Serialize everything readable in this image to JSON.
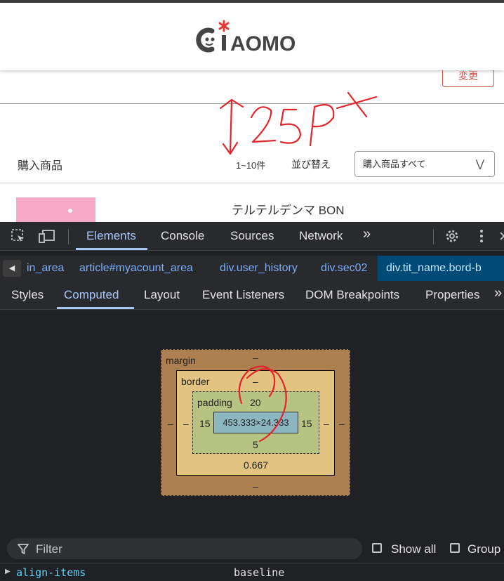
{
  "webpage": {
    "logo_text": "CiAOMO",
    "edit_button": "変更",
    "section_title": "購入商品",
    "item_count": "1~10件",
    "sort_label": "並び替え",
    "filter_select": {
      "value": "購入商品すべて"
    },
    "product_name": "テルテルデンマ BON",
    "annotation_text": "25px"
  },
  "devtools": {
    "main_tabs": [
      {
        "label": "Elements",
        "active": true
      },
      {
        "label": "Console"
      },
      {
        "label": "Sources"
      },
      {
        "label": "Network"
      }
    ],
    "more_tabs": "»",
    "breadcrumbs": [
      "in_area",
      "article#myacount_area",
      "div.user_history",
      "div.sec02",
      "div.tit_name.bord-b"
    ],
    "sub_tabs": [
      {
        "label": "Styles"
      },
      {
        "label": "Computed",
        "active": true
      },
      {
        "label": "Layout"
      },
      {
        "label": "Event Listeners"
      },
      {
        "label": "DOM Breakpoints"
      },
      {
        "label": "Properties"
      }
    ],
    "box_model": {
      "margin_label": "margin",
      "margin": {
        "top": "–",
        "right": "–",
        "bottom": "–",
        "left": "–"
      },
      "border_label": "border",
      "border": {
        "top": "–",
        "right": "–",
        "bottom": "0.667",
        "left": "–"
      },
      "padding_label": "padding",
      "padding": {
        "top": "20",
        "right": "15",
        "bottom": "5",
        "left": "15"
      },
      "content": "453.333×24.333"
    },
    "filter": {
      "placeholder": "Filter"
    },
    "show_all_label": "Show all",
    "group_label": "Group",
    "property": {
      "name": "align-items",
      "value": "baseline"
    },
    "colors": {
      "accent": "#a8c7fa",
      "margin": "#ad8052",
      "border": "#e3c381",
      "padding": "#b7c382",
      "content": "#8cb6c0",
      "annotation": "#e3242b"
    }
  }
}
